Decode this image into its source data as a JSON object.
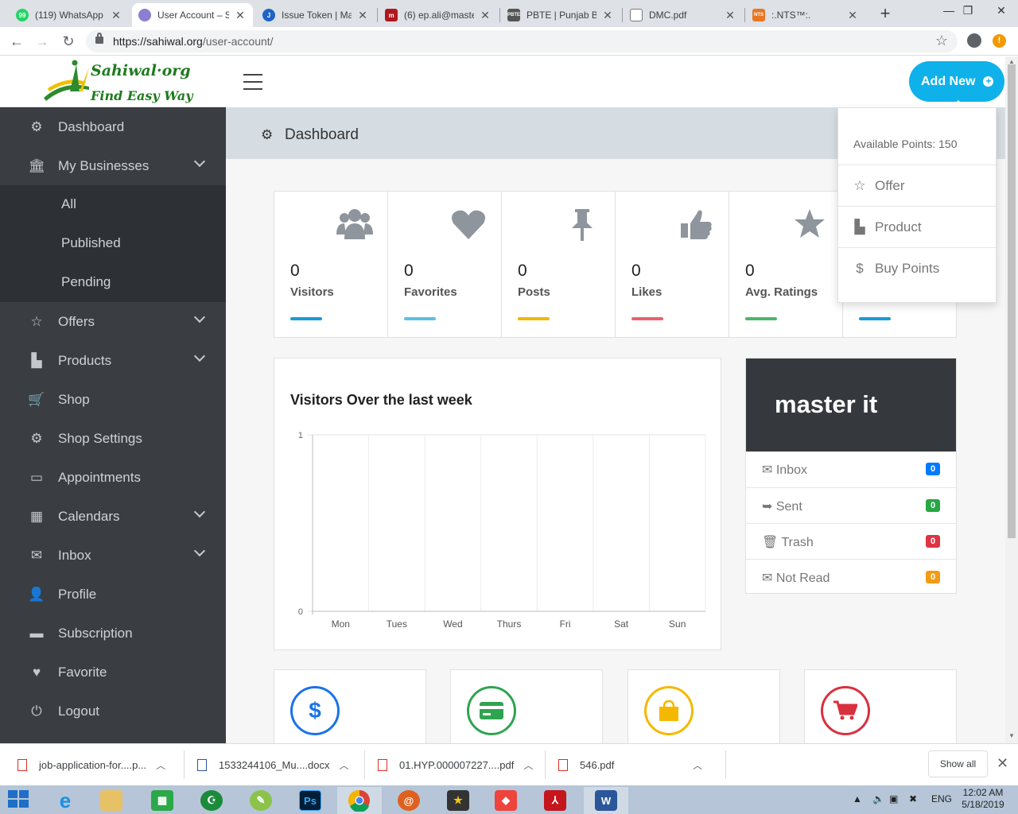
{
  "browser": {
    "tabs": [
      {
        "title": "(119) WhatsApp",
        "favicon": "whatsapp-icon"
      },
      {
        "title": "User Account – S",
        "favicon": "sahiwal-icon"
      },
      {
        "title": "Issue Token | Ma",
        "favicon": "jazz-icon"
      },
      {
        "title": "(6) ep.ali@maste",
        "favicon": "mail-icon"
      },
      {
        "title": "PBTE | Punjab Bo",
        "favicon": "pbte-icon"
      },
      {
        "title": "DMC.pdf",
        "favicon": "document-icon"
      },
      {
        "title": ":.NTS™:.",
        "favicon": "nts-icon"
      }
    ],
    "active_tab": 1,
    "address": {
      "host": "https://sahiwal.org",
      "path": "/user-account/"
    }
  },
  "logo": {
    "line1": "Sahiwal·org",
    "line2": "Find Easy Way"
  },
  "sidebar": {
    "items": [
      {
        "label": "Dashboard",
        "icon": "cogs-icon",
        "expandable": false
      },
      {
        "label": "My Businesses",
        "icon": "bank-icon",
        "expandable": true
      },
      {
        "label": "Offers",
        "icon": "star-icon",
        "expandable": true
      },
      {
        "label": "Products",
        "icon": "briefcase-icon",
        "expandable": true
      },
      {
        "label": "Shop",
        "icon": "cart-icon",
        "expandable": false
      },
      {
        "label": "Shop Settings",
        "icon": "gear-icon",
        "expandable": false
      },
      {
        "label": "Appointments",
        "icon": "calendar-icon",
        "expandable": false
      },
      {
        "label": "Calendars",
        "icon": "calendar-grid-icon",
        "expandable": true
      },
      {
        "label": "Inbox",
        "icon": "envelope-icon",
        "expandable": true
      },
      {
        "label": "Profile",
        "icon": "user-icon",
        "expandable": false
      },
      {
        "label": "Subscription",
        "icon": "credit-card-icon",
        "expandable": false
      },
      {
        "label": "Favorite",
        "icon": "heart-icon",
        "expandable": false
      },
      {
        "label": "Logout",
        "icon": "power-icon",
        "expandable": false
      }
    ],
    "subitems": [
      "All",
      "Published",
      "Pending"
    ]
  },
  "header": {
    "add_new_label": "Add New",
    "page_title": "Dashboard"
  },
  "dropdown": {
    "points_text": "Available Points: 150",
    "items": [
      {
        "label": "Offer",
        "icon": "star-outline-icon"
      },
      {
        "label": "Product",
        "icon": "briefcase-icon"
      },
      {
        "label": "Buy Points",
        "icon": "dollar-icon"
      }
    ]
  },
  "stats": [
    {
      "value": "0",
      "label": "Visitors",
      "color": "#1a9bd7",
      "icon": "users-icon"
    },
    {
      "value": "0",
      "label": "Favorites",
      "color": "#5bc0de",
      "icon": "heart-icon"
    },
    {
      "value": "0",
      "label": "Posts",
      "color": "#f0b800",
      "icon": "pin-icon"
    },
    {
      "value": "0",
      "label": "Likes",
      "color": "#e8636a",
      "icon": "thumbs-up-icon"
    },
    {
      "value": "0",
      "label": "Avg. Ratings",
      "color": "#4bb76a",
      "icon": "star-icon"
    },
    {
      "value": "",
      "label": "",
      "color": "#1a9bd7",
      "icon": ""
    }
  ],
  "chart_data": {
    "type": "line",
    "title": "Visitors Over the last week",
    "categories": [
      "Mon",
      "Tues",
      "Wed",
      "Thurs",
      "Fri",
      "Sat",
      "Sun"
    ],
    "series": [
      {
        "values": [
          0,
          0,
          0,
          0,
          0,
          0,
          0
        ]
      }
    ],
    "ylim": [
      0,
      1
    ],
    "yticks": [
      "0",
      "1"
    ],
    "grid": true
  },
  "mail": {
    "name": "master it",
    "rows": [
      {
        "label": "Inbox",
        "count": "0",
        "color": "#007bff",
        "icon": "envelope-icon"
      },
      {
        "label": "Sent",
        "count": "0",
        "color": "#28a745",
        "icon": "sign-out-icon"
      },
      {
        "label": "Trash",
        "count": "0",
        "color": "#dc3545",
        "icon": "trash-icon"
      },
      {
        "label": "Not Read",
        "count": "0",
        "color": "#f39c12",
        "icon": "envelope-open-icon"
      }
    ]
  },
  "bottom_cards": [
    {
      "icon": "dollar-icon",
      "color": "#1a73e8"
    },
    {
      "icon": "credit-card-icon",
      "color": "#2ea44f"
    },
    {
      "icon": "shopping-bag-icon",
      "color": "#f5b800"
    },
    {
      "icon": "cart-icon",
      "color": "#d9303e"
    }
  ],
  "downloads": {
    "items": [
      "job-application-for....p...",
      "1533244106_Mu....docx",
      "01.HYP.000007227....pdf",
      "546.pdf"
    ],
    "show_all": "Show all"
  },
  "taskbar": {
    "lang": "ENG",
    "time": "12:02 AM",
    "date": "5/18/2019"
  }
}
